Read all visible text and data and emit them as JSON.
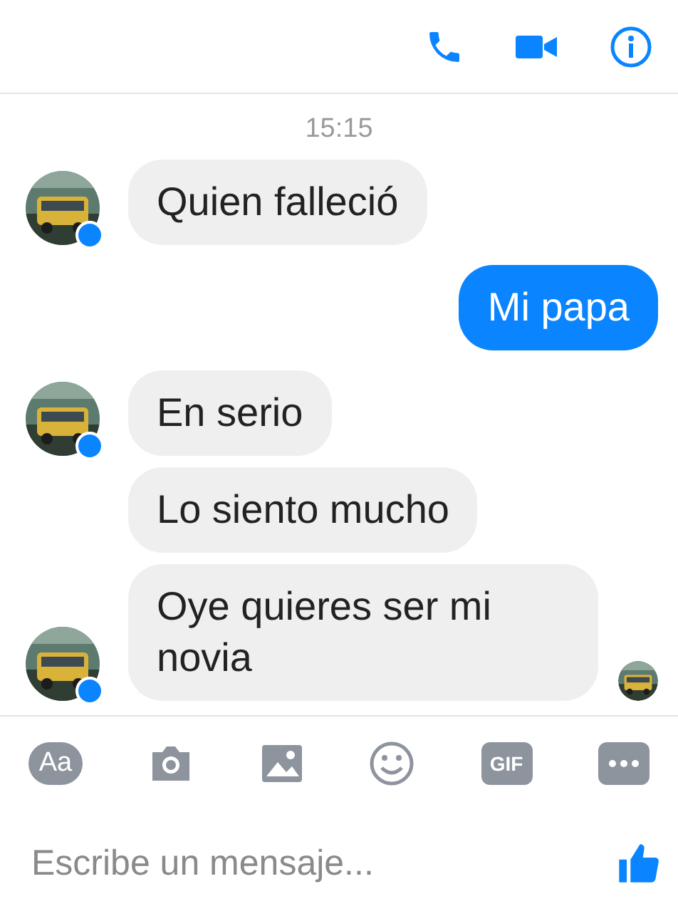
{
  "time": "15:15",
  "messages": [
    {
      "kind": "incoming",
      "text": "Quien falleció",
      "avatar": true,
      "seen": false
    },
    {
      "kind": "outgoing",
      "text": "Mi papa",
      "avatar": false,
      "seen": false
    },
    {
      "kind": "incoming",
      "text": "En serio",
      "avatar": true,
      "seen": false
    },
    {
      "kind": "incoming",
      "text": "Lo siento mucho",
      "avatar": false,
      "seen": false
    },
    {
      "kind": "incoming",
      "text": "Oye quieres ser mi novia",
      "avatar": true,
      "seen": true
    }
  ],
  "composer": {
    "font_label": "Aa",
    "gif_label": "GIF",
    "placeholder": "Escribe un mensaje..."
  }
}
